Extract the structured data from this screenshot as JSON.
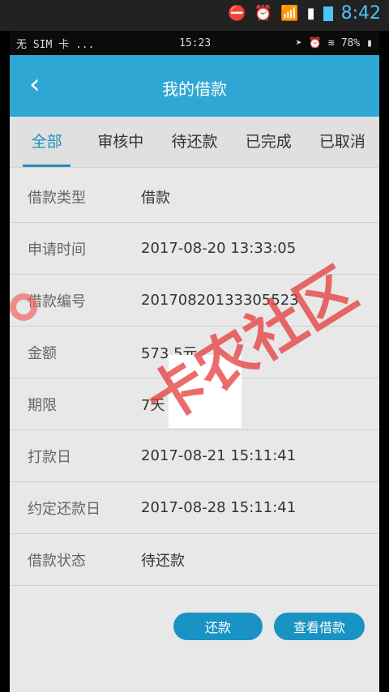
{
  "outer_status": {
    "time": "8:42"
  },
  "inner_status": {
    "carrier": "无 SIM 卡 ...",
    "time": "15:23",
    "battery": "78%"
  },
  "appbar": {
    "title": "我的借款"
  },
  "tabs": [
    {
      "label": "全部"
    },
    {
      "label": "审核中"
    },
    {
      "label": "待还款"
    },
    {
      "label": "已完成"
    },
    {
      "label": "已取消"
    }
  ],
  "loan": {
    "rows": [
      {
        "label": "借款类型",
        "value": "借款"
      },
      {
        "label": "申请时间",
        "value": "2017-08-20 13:33:05"
      },
      {
        "label": "借款编号",
        "value": "20170820133305523"
      },
      {
        "label": "金额",
        "value": "573.5元"
      },
      {
        "label": "期限",
        "value": "7天"
      },
      {
        "label": "打款日",
        "value": "2017-08-21 15:11:41"
      },
      {
        "label": "约定还款日",
        "value": "2017-08-28 15:11:41"
      },
      {
        "label": "借款状态",
        "value": "待还款"
      }
    ]
  },
  "actions": {
    "repay_label": "还款",
    "view_label": "查看借款"
  },
  "watermark": {
    "text": "卡农社区"
  }
}
